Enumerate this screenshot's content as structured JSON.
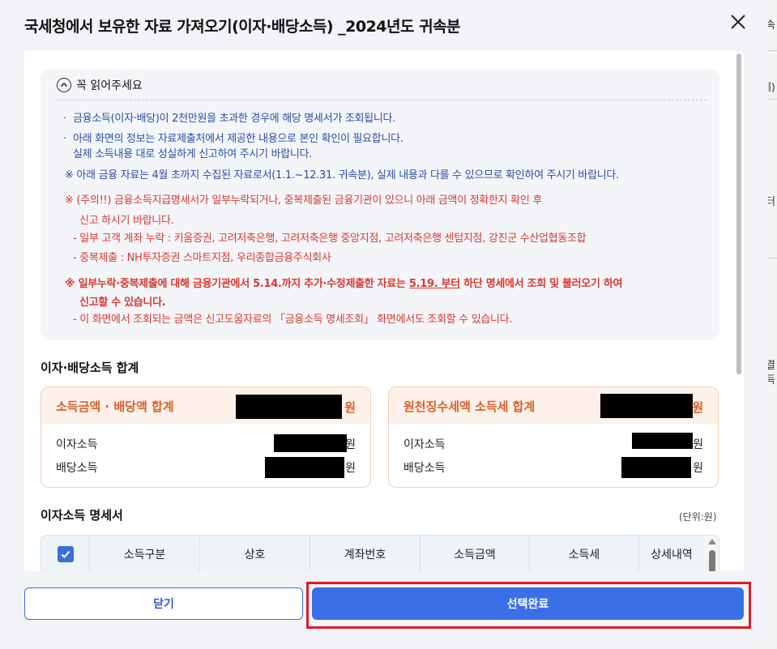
{
  "background_fragments": [
    "속",
    "세)",
    "터",
    "연결",
    "소득"
  ],
  "modal": {
    "title": "국세청에서 보유한 자료 가져오기(이자·배당소득) _2024년도 귀속분",
    "close_icon": "close-icon"
  },
  "notice": {
    "heading": "꼭 읽어주세요",
    "lines": [
      "금융소득(이자·배당)이 2천만원을 초과한 경우에 해당 명세서가 조회됩니다.",
      "아래 화면의 정보는 자료제출처에서 제공한 내용으로 본인 확인이 필요합니다.",
      "실제 소득내용 대로 성실하게 신고하여 주시기 바랍니다.",
      "※ 아래 금융 자료는 4월 초까지 수집된 자료로서(1.1.~12.31. 귀속분), 실제 내용과 다를 수 있으므로 확인하여 주시기 바랍니다.",
      "※ (주의!!) 금융소득지급명세서가 일부누락되거나, 중복제출된 금융기관이 있으니 아래 금액이 정확한지 확인 후",
      "신고 하시기 바랍니다.",
      "- 일부 고객 계좌 누락 : 키움증권, 고려저축은행, 고려저축은행 중앙지점, 고려저축은행 센텀지점, 강진군 수산업협동조합",
      "- 중복제출 : NH투자증권 스마트지점, 우리종합금융주식회사"
    ],
    "bold_warning_a": "※ 일부누락·중복제출에 대해 금융기관에서 5.14.까지 추가·수정제출한 자료는 ",
    "bold_warning_underline": "5.19. 부터",
    "bold_warning_b": " 하단 명세에서 조회 및 불러오기 하여",
    "bold_warning_c": "신고할 수 있습니다.",
    "last_line": "- 이 화면에서 조회되는 금액은 신고도움자료의 「금융소득 명세조회」 화면에서도 조회할 수 있습니다."
  },
  "summary": {
    "section_title": "이자·배당소득 합계",
    "income_box": {
      "header": "소득금액 · 배당액 합계",
      "unit": "원",
      "rows": [
        {
          "label": "이자소득",
          "unit": "원"
        },
        {
          "label": "배당소득",
          "unit": "원"
        }
      ]
    },
    "tax_box": {
      "header": "원천징수세액 소득세 합계",
      "unit": "원",
      "rows": [
        {
          "label": "이자소득",
          "unit": "원"
        },
        {
          "label": "배당소득",
          "unit": "원"
        }
      ]
    }
  },
  "detail": {
    "section_title": "이자소득 명세서",
    "unit_note": "(단위:원)",
    "columns": [
      "소득구분",
      "상호",
      "계좌번호",
      "소득금액",
      "소득세",
      "상세내역"
    ]
  },
  "buttons": {
    "close_label": "닫기",
    "confirm_label": "선택완료"
  },
  "colors": {
    "accent": "#3a6fe6",
    "warning": "#d93a30",
    "notice_blue": "#2a4ea6",
    "summary_orange": "#d9602b",
    "highlight": "#e01b24"
  }
}
